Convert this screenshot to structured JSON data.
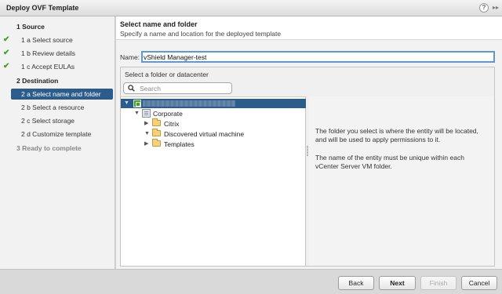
{
  "window": {
    "title": "Deploy OVF Template",
    "help_glyph": "?",
    "expand_glyph": "▸▸"
  },
  "nav": {
    "items": [
      {
        "label": "1  Source",
        "kind": "section",
        "checked": false
      },
      {
        "label": "1 a  Select source",
        "kind": "step",
        "checked": true
      },
      {
        "label": "1 b  Review details",
        "kind": "step",
        "checked": true
      },
      {
        "label": "1 c  Accept EULAs",
        "kind": "step",
        "checked": true
      },
      {
        "label": "2  Destination",
        "kind": "section",
        "checked": false
      },
      {
        "label": "2 a  Select name and folder",
        "kind": "step",
        "selected": true
      },
      {
        "label": "2 b  Select a resource",
        "kind": "step"
      },
      {
        "label": "2 c  Select storage",
        "kind": "step"
      },
      {
        "label": "2 d  Customize template",
        "kind": "step"
      },
      {
        "label": "3  Ready to complete",
        "kind": "disabled"
      }
    ]
  },
  "header": {
    "title": "Select name and folder",
    "subtitle": "Specify a name and location for the deployed template"
  },
  "name_field": {
    "label": "Name:",
    "value": "vShield Manager-test"
  },
  "folder_panel": {
    "caption": "Select a folder or datacenter",
    "search_placeholder": "Search",
    "tree": [
      {
        "label": "Corporate",
        "expanded": true
      },
      {
        "label": "Citrix",
        "expanded": false
      },
      {
        "label": "Discovered virtual machine",
        "expanded": true
      },
      {
        "label": "Templates",
        "expanded": false
      }
    ]
  },
  "info": {
    "p1": "The folder you select is where the entity will be located, and will be used to apply permissions to it.",
    "p2": "The name of the entity must be unique within each vCenter Server VM folder."
  },
  "buttons": {
    "back": "Back",
    "next": "Next",
    "finish": "Finish",
    "cancel": "Cancel"
  },
  "icons": {
    "check": "checkmark-icon",
    "datacenter": "datacenter-icon",
    "folder": "folder-icon",
    "search": "search-icon"
  },
  "colors": {
    "selection": "#2c5c8c",
    "check": "#4a9d33",
    "input_focus": "#5b9ad5"
  }
}
